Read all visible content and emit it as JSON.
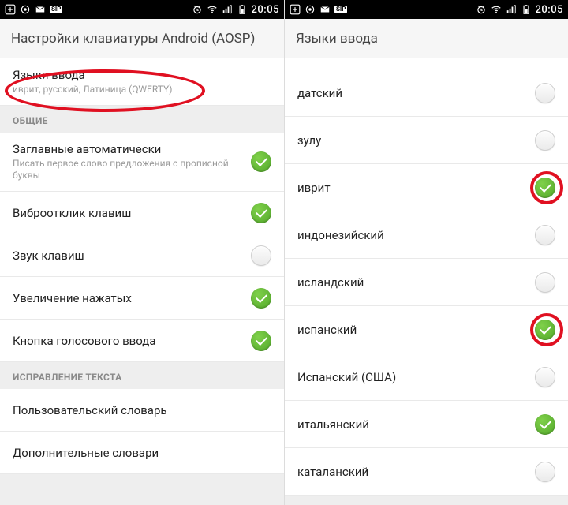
{
  "colors": {
    "accent_on": "#52a82a",
    "ring": "#e01021"
  },
  "status": {
    "icons_left": [
      "plus-icon",
      "target-icon",
      "mail-icon",
      "sip-icon"
    ],
    "icons_right": [
      "alarm-icon",
      "wifi-icon",
      "signal-icon",
      "battery-icon"
    ],
    "clock": "20:05"
  },
  "phoneA": {
    "title": "Настройки клавиатуры Android (AOSP)",
    "rows": [
      {
        "kind": "item",
        "title": "Языки ввода",
        "subtitle": "иврит, русский, Латиница (QWERTY)",
        "toggle": null,
        "ring_oval": true
      },
      {
        "kind": "section",
        "label": "ОБЩИЕ"
      },
      {
        "kind": "item",
        "title": "Заглавные автоматически",
        "subtitle": "Писать первое слово предложения с прописной буквы",
        "toggle": "on"
      },
      {
        "kind": "item",
        "title": "Виброотклик клавиш",
        "toggle": "on"
      },
      {
        "kind": "item",
        "title": "Звук клавиш",
        "toggle": "off"
      },
      {
        "kind": "item",
        "title": "Увеличение нажатых",
        "toggle": "on"
      },
      {
        "kind": "item",
        "title": "Кнопка голосового ввода",
        "toggle": "on"
      },
      {
        "kind": "section",
        "label": "ИСПРАВЛЕНИЕ ТЕКСТА"
      },
      {
        "kind": "item",
        "title": "Пользовательский словарь",
        "toggle": null
      },
      {
        "kind": "item",
        "title": "Дополнительные словари",
        "toggle": null
      }
    ]
  },
  "phoneB": {
    "title": "Языки ввода",
    "rows": [
      {
        "title": "датский",
        "toggle": "off"
      },
      {
        "title": "зулу",
        "toggle": "off"
      },
      {
        "title": "иврит",
        "toggle": "on",
        "ring": true
      },
      {
        "title": "индонезийский",
        "toggle": "off"
      },
      {
        "title": "исландский",
        "toggle": "off"
      },
      {
        "title": "испанский",
        "toggle": "on",
        "ring": true
      },
      {
        "title": "Испанский (США)",
        "toggle": "off"
      },
      {
        "title": "итальянский",
        "toggle": "on"
      },
      {
        "title": "каталанский",
        "toggle": "off"
      }
    ]
  }
}
